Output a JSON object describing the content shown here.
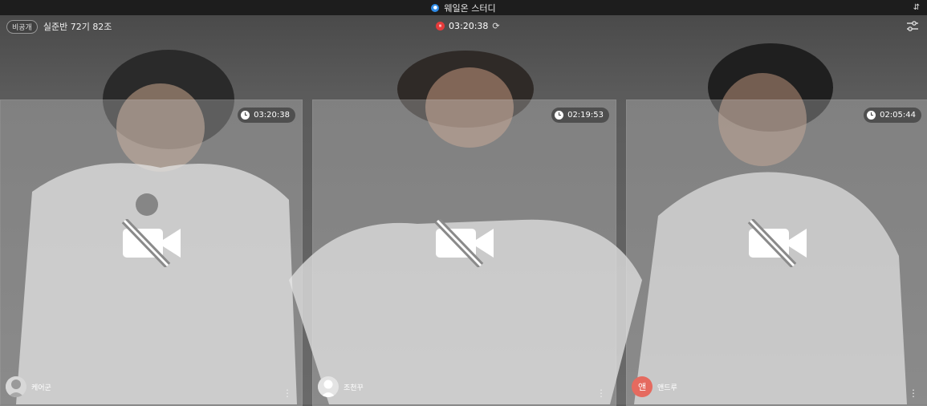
{
  "window": {
    "title": "웨일온 스터디",
    "logo_icon": "whale-on-logo-icon"
  },
  "header": {
    "privacy_badge": "비공개",
    "room_name": "실준반 72기 82조",
    "session_timer": "03:20:38",
    "rec_glyph": "⏸"
  },
  "participants": [
    {
      "name": "케어군",
      "timer": "03:20:38",
      "avatar_type": "image"
    },
    {
      "name": "조천꾸",
      "timer": "02:19:53",
      "avatar_type": "default"
    },
    {
      "name": "앤드루",
      "timer": "02:05:44",
      "avatar_type": "initial",
      "initial": "앤",
      "avatar_color": "#e56a5f"
    }
  ],
  "icons": {
    "sort": "sort-icon",
    "settings": "sliders-icon",
    "refresh": "refresh-icon",
    "camera_off": "camera-off-icon",
    "more": "more-vertical-icon",
    "clock": "clock-icon"
  },
  "colors": {
    "rec": "#e53b3b",
    "logo": "#2f8ce8",
    "titlebar": "#1d1d1d"
  }
}
